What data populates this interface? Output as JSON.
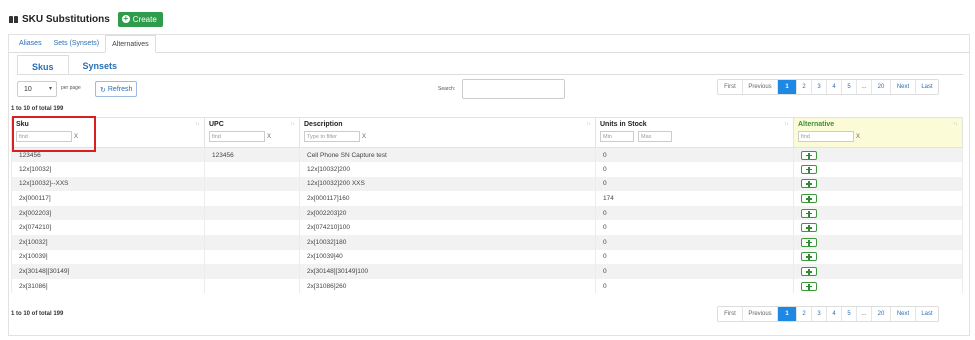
{
  "header": {
    "title": "SKU Substitutions",
    "create_label": "Create"
  },
  "outer_tabs": [
    "Aliases",
    "Sets (Synsets)",
    "Alternatives"
  ],
  "inner_tabs": [
    "Skus",
    "Synsets"
  ],
  "controls": {
    "per_page_value": "10",
    "per_page_label": "per page",
    "refresh_label": "Refresh",
    "search_label": "Search:",
    "search_value": ""
  },
  "pagination": [
    "First",
    "Previous",
    "1",
    "2",
    "3",
    "4",
    "5",
    "...",
    "20",
    "Next",
    "Last"
  ],
  "pagination_active": "1",
  "summary_top": "1 to 10 of total 199",
  "summary_bottom": "1 to 10 of total 199",
  "table": {
    "columns": {
      "sku": {
        "label": "Sku",
        "filter_placeholder": "find"
      },
      "upc": {
        "label": "UPC",
        "filter_placeholder": "find"
      },
      "description": {
        "label": "Description",
        "filter_placeholder": "Type to filter"
      },
      "units": {
        "label": "Units in Stock",
        "min_placeholder": "Min",
        "max_placeholder": "Max"
      },
      "alternative": {
        "label": "Alternative",
        "filter_placeholder": "find"
      }
    },
    "clear_symbol": "X",
    "rows": [
      {
        "sku": "123456",
        "upc": "123456",
        "description": "Cell Phone SN Capture test",
        "units": "0"
      },
      {
        "sku": "12x[10032]",
        "upc": "",
        "description": "12x[10032]200",
        "units": "0"
      },
      {
        "sku": "12x[10032]--XXS",
        "upc": "",
        "description": "12x[10032]200 XXS",
        "units": "0"
      },
      {
        "sku": "2x[000117]",
        "upc": "",
        "description": "2x[000117]160",
        "units": "174"
      },
      {
        "sku": "2x[002203]",
        "upc": "",
        "description": "2x[002203]20",
        "units": "0"
      },
      {
        "sku": "2x[074210]",
        "upc": "",
        "description": "2x[074210]100",
        "units": "0"
      },
      {
        "sku": "2x[10032]",
        "upc": "",
        "description": "2x[10032]180",
        "units": "0"
      },
      {
        "sku": "2x[10039]",
        "upc": "",
        "description": "2x[10039]40",
        "units": "0"
      },
      {
        "sku": "2x[30148][30149]",
        "upc": "",
        "description": "2x[30148][30149]100",
        "units": "0"
      },
      {
        "sku": "2x[31086]",
        "upc": "",
        "description": "2x[31086]260",
        "units": "0"
      }
    ]
  },
  "colors": {
    "accent": "#1e88e5",
    "create_green": "#2e9c4a",
    "highlight": "#d92020",
    "alt_header_bg": "#fbfbd8"
  }
}
